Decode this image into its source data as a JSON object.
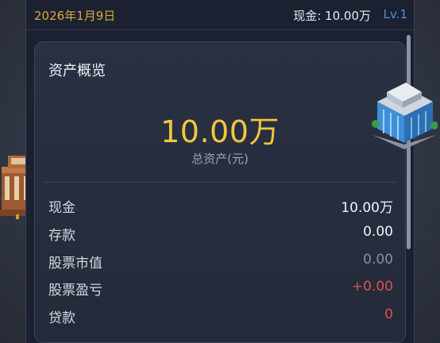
{
  "header": {
    "date": "2026年1月9日",
    "cash": "现金: 10.00万",
    "level": "Lv.1"
  },
  "overview": {
    "title": "资产概览",
    "total_value": "10.00万",
    "total_label": "总资产(元)",
    "rows": [
      {
        "label": "现金",
        "value": "10.00万"
      },
      {
        "label": "存款",
        "value": "0.00"
      },
      {
        "label": "股票市值",
        "value": "0.00"
      },
      {
        "label": "股票盈亏",
        "value": "+0.00"
      },
      {
        "label": "贷款",
        "value": "0"
      }
    ]
  },
  "colors": {
    "accent_gold": "#f4c63a",
    "level_blue": "#4f8fe0",
    "loss_red": "#e0504b"
  },
  "icons": [
    "office-building-icon",
    "bank-building-icon"
  ]
}
